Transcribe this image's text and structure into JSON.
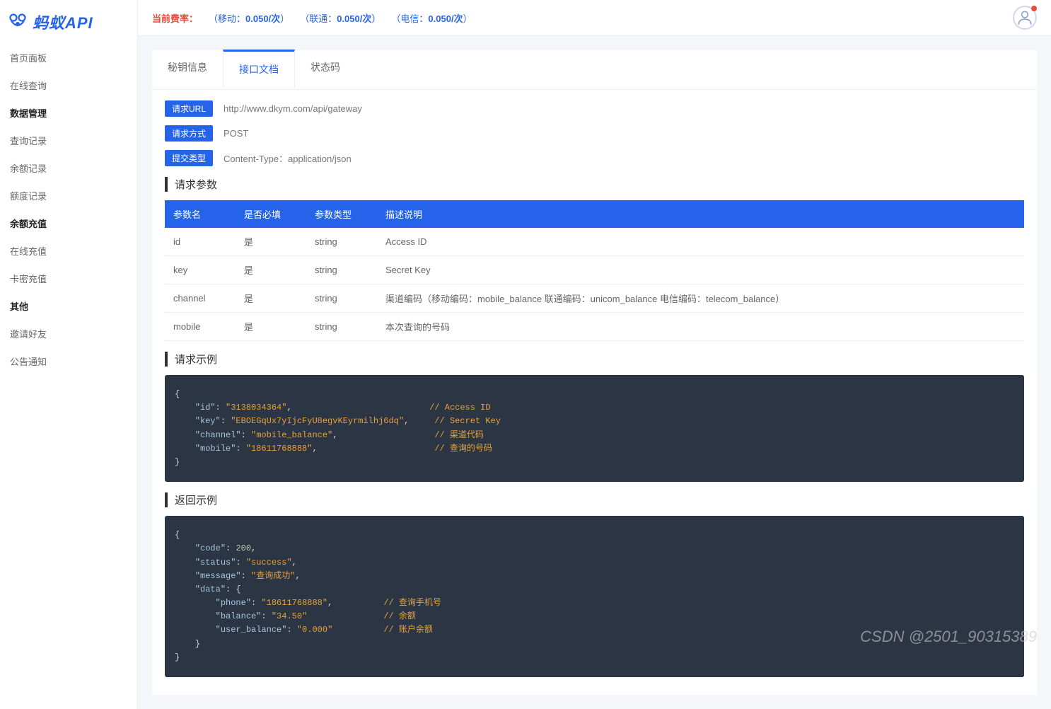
{
  "brand": "蚂蚁API",
  "topbar": {
    "rates_label": "当前费率：",
    "mobile_label": "（移动：",
    "mobile_rate": "0.050/次",
    "unicom_label": "（联通：",
    "unicom_rate": "0.050/次",
    "telecom_label": "（电信：",
    "telecom_rate": "0.050/次",
    "close": "）"
  },
  "sidebar": {
    "items": [
      {
        "label": "首页面板",
        "type": "item"
      },
      {
        "label": "在线查询",
        "type": "item"
      },
      {
        "label": "数据管理",
        "type": "header"
      },
      {
        "label": "查询记录",
        "type": "item"
      },
      {
        "label": "余额记录",
        "type": "item"
      },
      {
        "label": "额度记录",
        "type": "item"
      },
      {
        "label": "余额充值",
        "type": "header"
      },
      {
        "label": "在线充值",
        "type": "item"
      },
      {
        "label": "卡密充值",
        "type": "item"
      },
      {
        "label": "其他",
        "type": "header"
      },
      {
        "label": "邀请好友",
        "type": "item"
      },
      {
        "label": "公告通知",
        "type": "item"
      }
    ]
  },
  "tabs": [
    {
      "label": "秘钥信息",
      "active": false
    },
    {
      "label": "接口文档",
      "active": true
    },
    {
      "label": "状态码",
      "active": false
    }
  ],
  "api_info": {
    "url_label": "请求URL",
    "url_value": "http://www.dkym.com/api/gateway",
    "method_label": "请求方式",
    "method_value": "POST",
    "content_label": "提交类型",
    "content_value": "Content-Type：application/json"
  },
  "params": {
    "title": "请求参数",
    "headers": [
      "参数名",
      "是否必填",
      "参数类型",
      "描述说明"
    ],
    "rows": [
      {
        "name": "id",
        "required": "是",
        "type": "string",
        "desc": "Access ID"
      },
      {
        "name": "key",
        "required": "是",
        "type": "string",
        "desc": "Secret Key"
      },
      {
        "name": "channel",
        "required": "是",
        "type": "string",
        "desc": "渠道编码（移动编码：mobile_balance 联通编码：unicom_balance 电信编码：telecom_balance）"
      },
      {
        "name": "mobile",
        "required": "是",
        "type": "string",
        "desc": "本次查询的号码"
      }
    ]
  },
  "req_example": {
    "title": "请求示例",
    "lines": [
      "{",
      "    \"id\": \"3138034364\",                           // Access ID",
      "    \"key\": \"EBOEGqUx7yIjcFyU8egvKEyrmilhj6dq\",     // Secret Key",
      "    \"channel\": \"mobile_balance\",                   // 渠道代码",
      "    \"mobile\": \"18611768888\",                       // 查询的号码",
      "}"
    ]
  },
  "res_example": {
    "title": "返回示例",
    "lines": [
      "{",
      "    \"code\": 200,",
      "    \"status\": \"success\",",
      "    \"message\": \"查询成功\",",
      "    \"data\": {",
      "        \"phone\": \"18611768888\",          // 查询手机号",
      "        \"balance\": \"34.50\"               // 余额",
      "        \"user_balance\": \"0.000\"          // 账户余额",
      "    }",
      "}"
    ]
  },
  "watermark": "CSDN @2501_90315389"
}
